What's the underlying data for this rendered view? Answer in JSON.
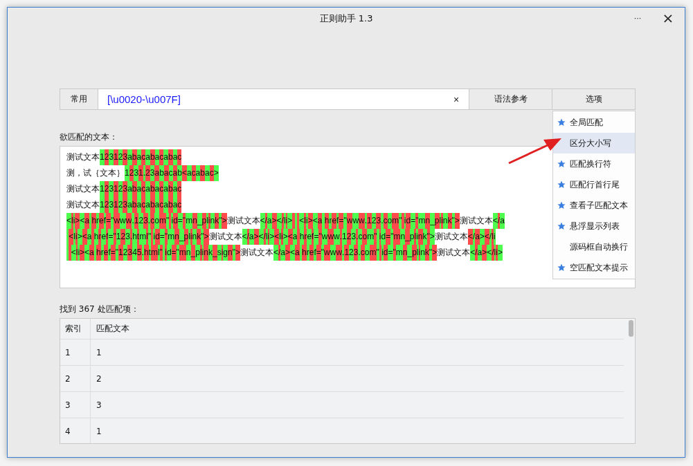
{
  "window": {
    "title": "正则助手 1.3",
    "more": "···",
    "close": "×"
  },
  "toolbar": {
    "common_button": "常用",
    "pattern": "[\\u0020-\\u007F]",
    "clear": "×",
    "syntax_button": "语法参考",
    "options_button": "选项"
  },
  "source": {
    "label": "欲匹配的文本：",
    "lines": [
      [
        {
          "text": "测试文本",
          "match": false
        },
        {
          "text": "123123abacabacabac",
          "match": true
        }
      ],
      [
        {
          "text": "测，试｛文本｝",
          "match": false
        },
        {
          "text": "1231.23abacab<acabac>",
          "match": true
        }
      ],
      [
        {
          "text": "测试文本",
          "match": false
        },
        {
          "text": "123123abacabacabac",
          "match": true
        }
      ],
      [
        {
          "text": "测试文本",
          "match": false
        },
        {
          "text": "123123abacabacabac",
          "match": true
        }
      ],
      [
        {
          "text": "<li><a href=\"www.123.com\" id=\"mn_plink\">",
          "match": true
        },
        {
          "text": "测试文本",
          "match": false
        },
        {
          "text": "</a></li>   <li><a href=\"www.123.com\" id=\"mn_plink\">",
          "match": true
        },
        {
          "text": "测试文本",
          "match": false
        },
        {
          "text": "</a",
          "match": true
        }
      ],
      [
        {
          "text": " <li><a href=\"123.html\" id=\"mn_plink\">",
          "match": true
        },
        {
          "text": "测试文本",
          "match": false
        },
        {
          "text": "</a></li><li><a href=\"www.123.com\" id=\"mn_plink\">",
          "match": true
        },
        {
          "text": "测试文本",
          "match": false
        },
        {
          "text": "</a></li",
          "match": true
        }
      ],
      [
        {
          "text": "  <li><a href=\"12345.html\" id=\"mn_plink_sign\">",
          "match": true
        },
        {
          "text": "测试文本",
          "match": false
        },
        {
          "text": "</a><a href=\"www.123.com\" id=\"mn_plink\">",
          "match": true
        },
        {
          "text": "测试文本",
          "match": false
        },
        {
          "text": "</a></li>",
          "match": true
        }
      ]
    ]
  },
  "results": {
    "label": "找到 367 处匹配项：",
    "columns": [
      "索引",
      "匹配文本"
    ],
    "rows": [
      [
        "1",
        "1"
      ],
      [
        "2",
        "2"
      ],
      [
        "3",
        "3"
      ],
      [
        "4",
        "1"
      ]
    ]
  },
  "options_menu": [
    {
      "label": "全局匹配",
      "checked": true,
      "selected": false
    },
    {
      "label": "区分大小写",
      "checked": false,
      "selected": true
    },
    {
      "label": "匹配换行符",
      "checked": true,
      "selected": false
    },
    {
      "label": "匹配行首行尾",
      "checked": true,
      "selected": false
    },
    {
      "label": "查看子匹配文本",
      "checked": true,
      "selected": false
    },
    {
      "label": "悬浮显示列表",
      "checked": true,
      "selected": false
    },
    {
      "label": "源码框自动换行",
      "checked": false,
      "selected": false
    },
    {
      "label": "空匹配文本提示",
      "checked": true,
      "selected": false
    }
  ]
}
